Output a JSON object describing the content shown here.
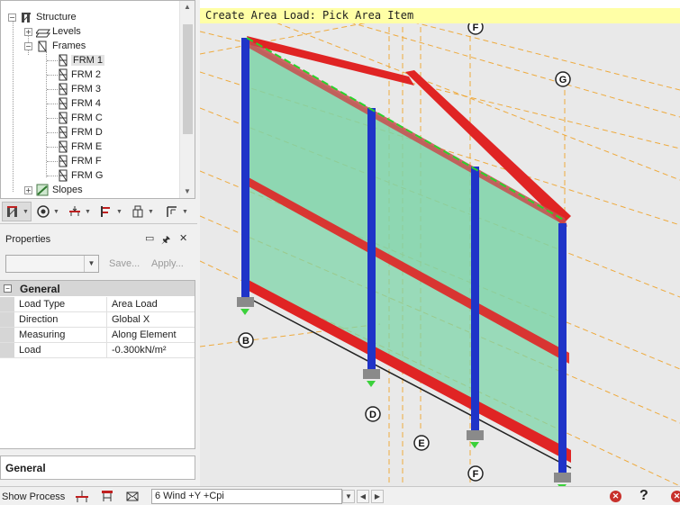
{
  "tree": {
    "items": [
      {
        "label": "Structure",
        "toggle": "−"
      },
      {
        "label": "Levels",
        "toggle": "+"
      },
      {
        "label": "Frames",
        "toggle": "−"
      },
      {
        "label": "FRM 1"
      },
      {
        "label": "FRM 2"
      },
      {
        "label": "FRM 3"
      },
      {
        "label": "FRM 4"
      },
      {
        "label": "FRM C"
      },
      {
        "label": "FRM D"
      },
      {
        "label": "FRM E"
      },
      {
        "label": "FRM F"
      },
      {
        "label": "FRM G"
      },
      {
        "label": "Slopes",
        "toggle": "+"
      }
    ],
    "selected": "FRM 1"
  },
  "properties": {
    "title": "Properties",
    "pin_glyph": "🖈",
    "menu_glyph": "▭",
    "close_glyph": "✕",
    "save_label": "Save...",
    "apply_label": "Apply...",
    "category": "General",
    "toggle": "−",
    "rows": [
      {
        "key": "Load Type",
        "value": "Area Load"
      },
      {
        "key": "Direction",
        "value": "Global X"
      },
      {
        "key": "Measuring",
        "value": "Along Element"
      },
      {
        "key": "Load",
        "value": "-0.300kN/m²"
      }
    ],
    "description_title": "General"
  },
  "viewport": {
    "prompt": "Create Area Load: Pick Area Item",
    "grid_labels": [
      "F",
      "G",
      "B",
      "D",
      "E",
      "F"
    ]
  },
  "status": {
    "show_process": "Show Process",
    "load_case": "6 Wind +Y +Cpi",
    "prev": "◀",
    "next": "▶",
    "help": "?"
  },
  "colors": {
    "column": "#1f34c8",
    "beam": "#e02424",
    "panel": "#7ed4a8",
    "gridline": "#f0a020",
    "prompt_bg": "#ffffa6"
  }
}
